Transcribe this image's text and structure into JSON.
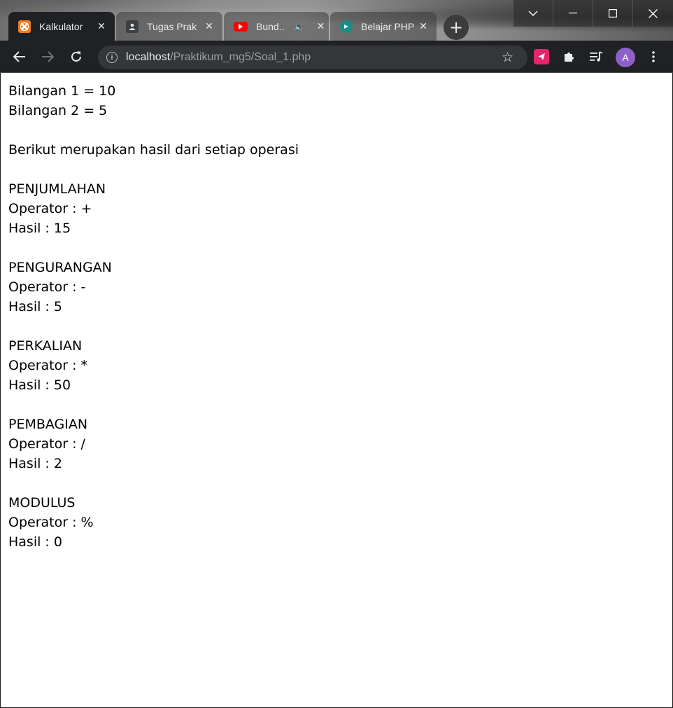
{
  "browser": {
    "tabs": [
      {
        "label": "Kalkulator",
        "icon": "xampp-icon",
        "active": true
      },
      {
        "label": "Tugas Prak",
        "icon": "classroom-icon",
        "active": false
      },
      {
        "label": "Bund..",
        "icon": "youtube-icon",
        "active": false,
        "audio": true
      },
      {
        "label": "Belajar PHP",
        "icon": "web-icon",
        "active": false
      }
    ],
    "close_glyph": "✕",
    "new_tab_glyph": "+",
    "window_controls": {
      "dropdown": "⌵",
      "minimize": "—",
      "maximize": "☐",
      "close": "✕"
    },
    "nav": {
      "back": "←",
      "forward": "→",
      "reload": "↻"
    },
    "address": {
      "host": "localhost",
      "path": "/Praktikum_mg5/Soal_1.php"
    },
    "profile_initial": "A",
    "colors": {
      "toolbar": "#202124",
      "omnibox": "#35363a",
      "avatar": "#8e60c9",
      "xampp": "#f37b22",
      "youtube": "#ff0000"
    }
  },
  "page": {
    "lines": [
      "Bilangan 1 = 10",
      "Bilangan 2 = 5",
      "",
      "Berikut merupakan hasil dari setiap operasi",
      "",
      "PENJUMLAHAN",
      "Operator : +",
      "Hasil : 15",
      "",
      "PENGURANGAN",
      "Operator : -",
      "Hasil : 5",
      "",
      "PERKALIAN",
      "Operator : *",
      "Hasil : 50",
      "",
      "PEMBAGIAN",
      "Operator : /",
      "Hasil : 2",
      "",
      "MODULUS",
      "Operator : %",
      "Hasil : 0"
    ]
  }
}
